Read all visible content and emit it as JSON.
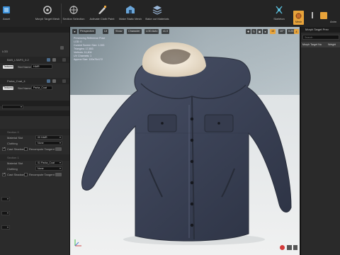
{
  "toolbar": {
    "save_label": "Save",
    "browse_label": "Browse",
    "reimport_label": "Reimport",
    "create_asset_label": "Create Asset",
    "recompute_label": "Recompute",
    "morph_label": "Morph Targets",
    "preview_label": "Preview",
    "section_selection_label": "Section Selection",
    "activate_cloth_label": "Activate Cloth Paint",
    "make_static_mesh_label": "Make Static Mesh",
    "bake_materials_label": "Bake out Materials",
    "skeleton_label": "Skeleton",
    "mesh_label": "Mesh",
    "animation_label": "Animation",
    "left_partial_1": "Asset",
    "left_partial_2": "Morph Target Mesh",
    "right_partial": "Anim"
  },
  "left_panel": {
    "row_lod": "LOD",
    "section_header_0": "Element 0",
    "element0_name": "BAB_LSAFS_0.2",
    "element0_material": "Textured",
    "element0_slot_label": "Slot Name",
    "element0_slot_value": "HAIR",
    "section_header_1": "Element 1",
    "element1_name": "Parka_Coat_4",
    "element1_material": "Textured",
    "element1_slot_label": "Slot Name",
    "element1_slot_value": "Parka_Coat",
    "sections_label": "Sections",
    "section0_header": "Section 0",
    "material_slot_label": "Material Slot",
    "section0_material_slot": "00 HAIR",
    "clothing_label": "Clothing",
    "section0_clothing": "None",
    "cast_shadow_label": "Cast Shadow",
    "recompute_tangent_label": "Recompute Tangent",
    "section1_header": "Section 1",
    "section1_material_slot": "01 Parka_Coat",
    "section1_clothing": "None"
  },
  "viewport": {
    "perspective_label": "Perspective",
    "lit_label": "Lit",
    "show_label": "Show",
    "character_label": "Character",
    "lod_auto_label": "LOD Auto",
    "speed_label": "x1.0",
    "stats": [
      "Previewing Reference Pose",
      "LOD: 0",
      "Current Screen Size: 1.263",
      "Triangles: 17,853",
      "Vertices: 11,404",
      "UV Channels: 1",
      "Approx Size: 120x70x172"
    ],
    "grid_value": "10",
    "angle_value": "10°",
    "scale_value": "0.25",
    "camera_speed": "4"
  },
  "right_panel": {
    "tab_label": "Morph Target Prev",
    "search_placeholder": "Search",
    "col_name": "Morph Target Na",
    "col_weight": "Weight"
  },
  "colors": {
    "toolbar_bg": "#242424",
    "panel_bg": "#2b2b2b",
    "accent_orange": "#e8a33a",
    "jacket": "#3b4256",
    "fur": "#e8dccb"
  }
}
